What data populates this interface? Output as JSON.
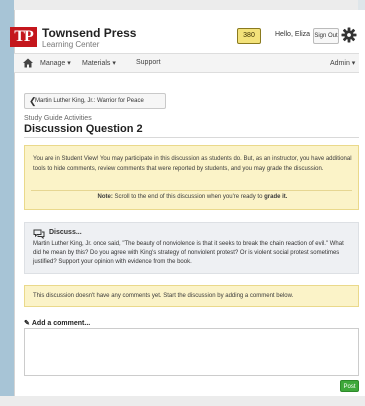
{
  "header": {
    "logo_text": "TP",
    "brand_name": "Townsend Press",
    "brand_sub": "Learning Center",
    "points": "380",
    "greeting": "Hello, Eliza",
    "signout_label": "Sign Out"
  },
  "nav": {
    "manage": "Manage ▾",
    "materials": "Materials ▾",
    "support": "Support",
    "admin": "Admin ▾"
  },
  "back_button": {
    "chevron": "❮",
    "label": "Martin Luther King, Jr.: Warrior for Peace"
  },
  "breadcrumb": "Study Guide Activities",
  "page_title": "Discussion Question 2",
  "notice": {
    "text": "You are in Student View! You may participate in this discussion as students do. But, as an instructor, you have additional tools to hide comments, review comments that were reported by students, and you may grade the discussion.",
    "note_prefix": "Note:",
    "note_text": " Scroll to the end of this discussion when you're ready to ",
    "note_bold": "grade it."
  },
  "discuss": {
    "title": "Discuss...",
    "body": "Martin Luther King, Jr. once said, \"The beauty of nonviolence is that it seeks to break the chain reaction of evil.\" What did he mean by this? Do you agree with King's strategy of nonviolent protest? Or is violent social protest sometimes justified? Support your opinion with evidence from the book."
  },
  "no_comments": "This discussion doesn't have any comments yet. Start the discussion by adding a comment below.",
  "comment": {
    "heading": "Add a comment...",
    "pencil": "✎",
    "value": ""
  },
  "submit_label": "Post",
  "colors": {
    "brand_red": "#c4161c",
    "notice_bg": "#fbf3c8",
    "discuss_bg": "#eef0f3",
    "submit_green": "#3ea83a"
  }
}
